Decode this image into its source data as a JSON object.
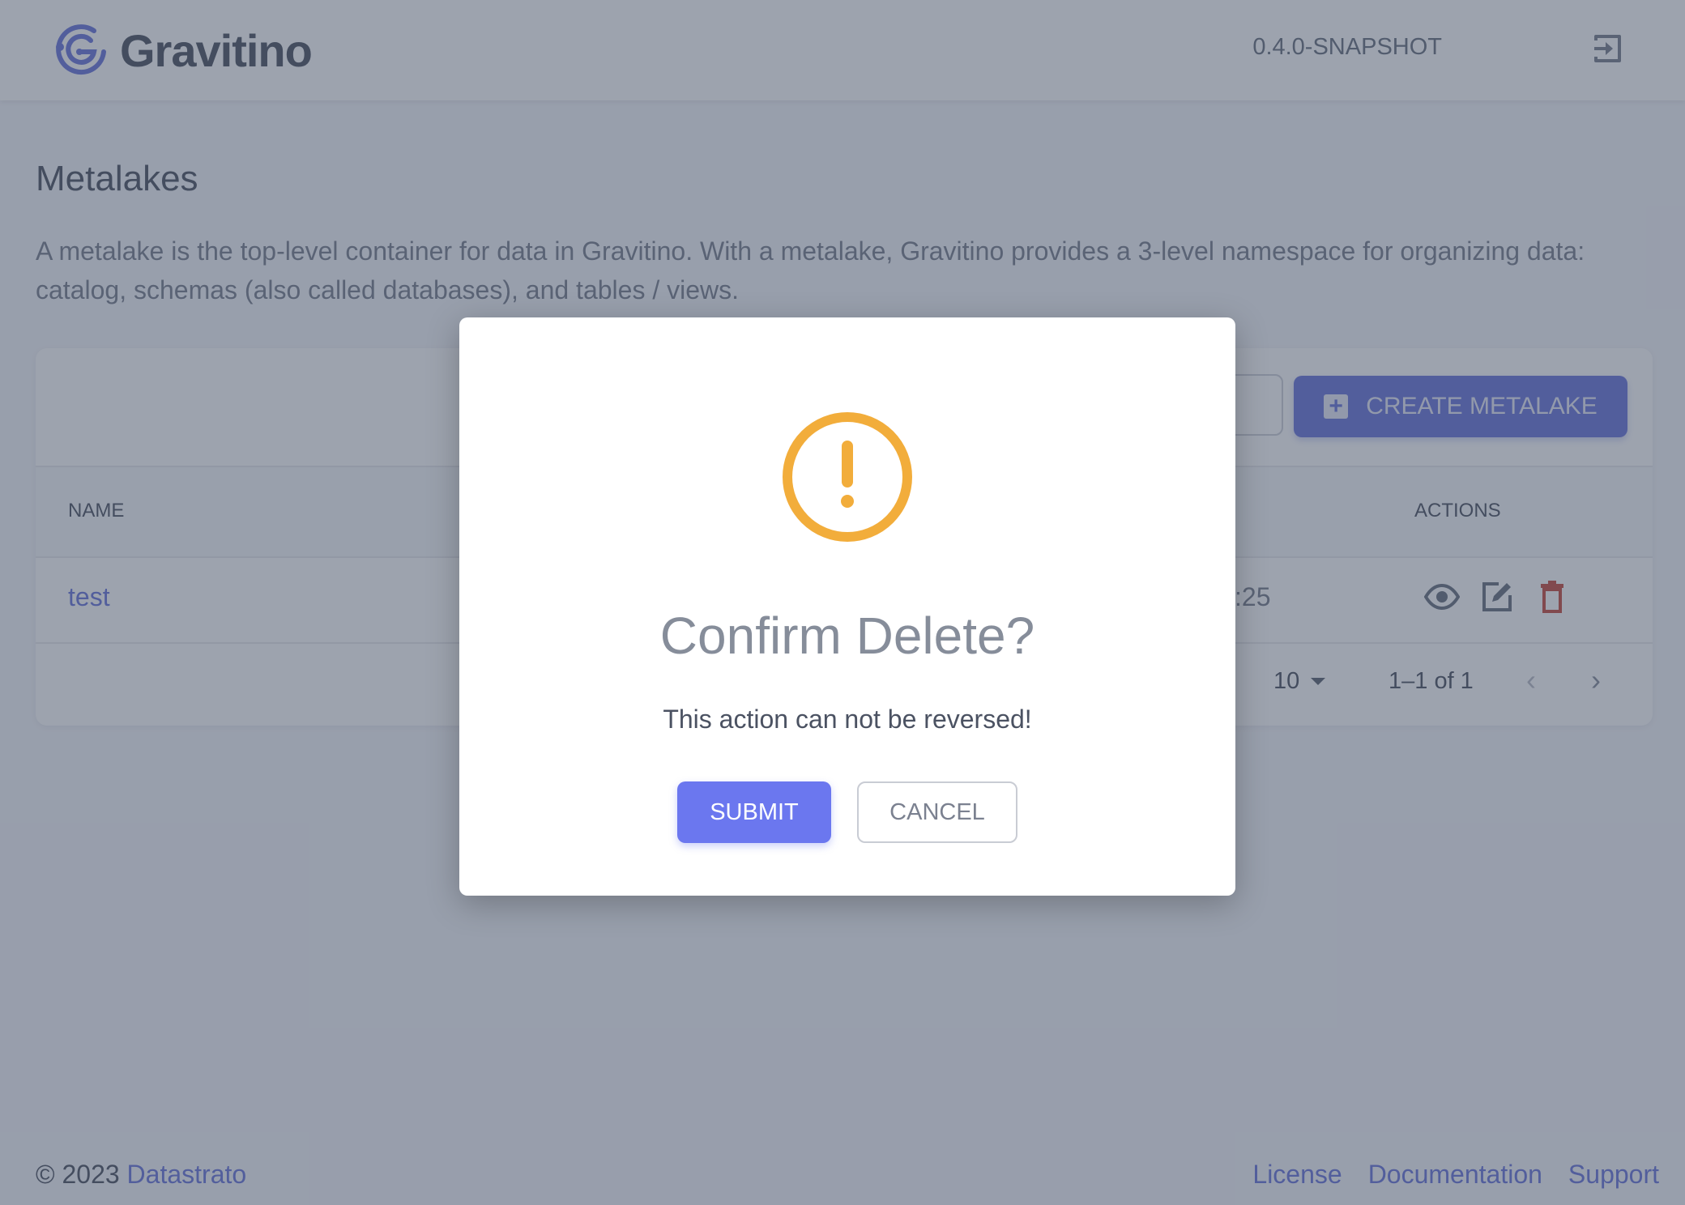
{
  "app": {
    "name": "Gravitino",
    "version": "0.4.0-SNAPSHOT",
    "logout_icon": "logout-icon",
    "brand_color": "#5a67d8"
  },
  "page": {
    "title": "Metalakes",
    "description": "A metalake is the top-level container for data in Gravitino. With a metalake, Gravitino provides a 3-level namespace for organizing data: catalog, schemas (also called databases), and tables / views."
  },
  "toolbar": {
    "search_placeholder": "",
    "create_label": "CREATE METALAKE"
  },
  "table": {
    "columns": [
      "NAME",
      "ACTIONS"
    ],
    "rows": [
      {
        "name": "test",
        "created_time_partial": ":25",
        "actions": [
          "view-icon",
          "edit-icon",
          "delete-icon"
        ]
      }
    ]
  },
  "pagination": {
    "rows_per_page": "10",
    "range": "1–1 of 1",
    "prev": "‹",
    "next": "›"
  },
  "footer": {
    "copyright": "© 2023",
    "company": "Datastrato",
    "links": [
      "License",
      "Documentation",
      "Support"
    ]
  },
  "dialog": {
    "icon": "warning-circle-icon",
    "icon_color": "#f2ad3b",
    "title": "Confirm Delete?",
    "message": "This action can not be reversed!",
    "submit_label": "SUBMIT",
    "cancel_label": "CANCEL"
  }
}
